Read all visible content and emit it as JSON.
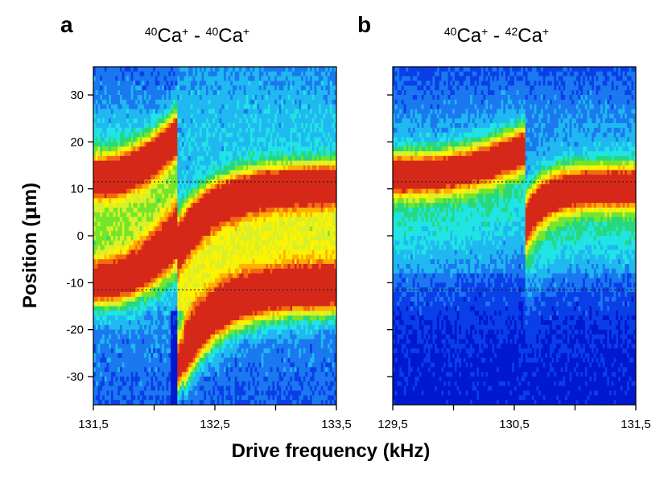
{
  "chart_data": [
    {
      "type": "heatmap",
      "panel_label": "a",
      "title": {
        "sup1": "40",
        "base1": "Ca",
        "sup2": "+",
        "sep": " - ",
        "sup3": "40",
        "base2": "Ca",
        "sup4": "+"
      },
      "xlim": [
        131.5,
        133.5
      ],
      "ylim": [
        -36,
        36
      ],
      "x_ticks": [
        131.5,
        132.0,
        132.5,
        133.0,
        133.5
      ],
      "x_tick_labels": [
        "131,5",
        "",
        "132,5",
        "",
        "133,5"
      ],
      "y_ticks": [
        30,
        20,
        10,
        0,
        -10,
        -20,
        -30
      ],
      "y_tick_labels": [
        "30",
        "20",
        "10",
        "0",
        "-10",
        "-20",
        "-30"
      ],
      "reference_lines": [
        11.5,
        -11.5
      ],
      "transition_x": 132.2,
      "ridges": [
        {
          "left_position": 12.5,
          "right_position": 11,
          "peak_before_transition": 22
        },
        {
          "left_position": -10,
          "right_position": -11,
          "peak_before_transition": 1
        }
      ]
    },
    {
      "type": "heatmap",
      "panel_label": "b",
      "title": {
        "sup1": "40",
        "base1": "Ca",
        "sup2": "+",
        "sep": " - ",
        "sup3": "42",
        "base2": "Ca",
        "sup4": "+"
      },
      "xlim": [
        129.5,
        131.5
      ],
      "ylim": [
        -36,
        36
      ],
      "x_ticks": [
        129.5,
        130.0,
        130.5,
        131.0,
        131.5
      ],
      "x_tick_labels": [
        "129,5",
        "",
        "130,5",
        "",
        "131,5"
      ],
      "y_ticks": [
        30,
        20,
        10,
        0,
        -10,
        -20,
        -30
      ],
      "y_tick_labels": [
        "",
        "",
        "",
        "",
        "",
        "",
        ""
      ],
      "reference_lines": [
        11.5,
        -11.5
      ],
      "transition_x": 130.6,
      "ridges": [
        {
          "left_position": 13,
          "right_position": 10.5,
          "peak_before_transition": 19
        }
      ]
    }
  ],
  "axes": {
    "ylabel_main": "Position (",
    "ylabel_mu": "μ",
    "ylabel_tail": "m)",
    "xlabel": "Drive frequency (kHz)"
  },
  "colors": {
    "colormap": [
      "#0018d0",
      "#0a3fe8",
      "#1b78f0",
      "#20b8f0",
      "#21e4e4",
      "#27d97b",
      "#74e52a",
      "#d8f02a",
      "#fff200",
      "#ffb000",
      "#f36a12",
      "#d62818"
    ]
  }
}
